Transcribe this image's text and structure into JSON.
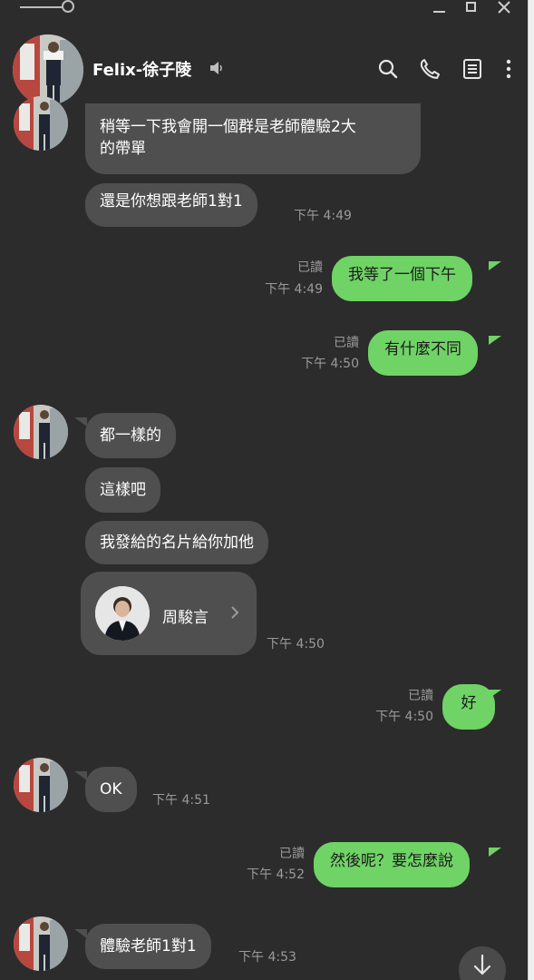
{
  "contact": {
    "name": "Felix-徐子陵"
  },
  "header_icons": [
    "speaker-icon",
    "search-icon",
    "phone-icon",
    "notes-icon",
    "more-icon"
  ],
  "messages": [
    {
      "side": "in",
      "text_line1": "稍等一下我會開一個群是老師體驗2大",
      "text_line2": "的帶單"
    },
    {
      "side": "in",
      "text": "還是你想跟老師1對1",
      "time": "下午 4:49"
    },
    {
      "side": "out",
      "text": "我等了一個下午",
      "read": "已讀",
      "time": "下午 4:49"
    },
    {
      "side": "out",
      "text": "有什麼不同",
      "read": "已讀",
      "time": "下午 4:50"
    },
    {
      "side": "in",
      "text": "都一樣的"
    },
    {
      "side": "in",
      "text": "這樣吧"
    },
    {
      "side": "in",
      "text": "我發給的名片給你加他"
    },
    {
      "side": "in",
      "type": "contact-card",
      "card_name": "周駿言",
      "time": "下午 4:50"
    },
    {
      "side": "out",
      "text": "好",
      "read": "已讀",
      "time": "下午 4:50"
    },
    {
      "side": "in",
      "text": "OK",
      "time": "下午 4:51"
    },
    {
      "side": "out",
      "text": "然後呢？要怎麼說",
      "read": "已讀",
      "time": "下午 4:52"
    },
    {
      "side": "in",
      "text": "體驗老師1對1",
      "time": "下午 4:53"
    }
  ],
  "colors": {
    "background": "#2c2c2c",
    "incoming_bubble": "#4f4f4f",
    "outgoing_bubble": "#6fd366",
    "meta_text": "#9a9a9a"
  }
}
